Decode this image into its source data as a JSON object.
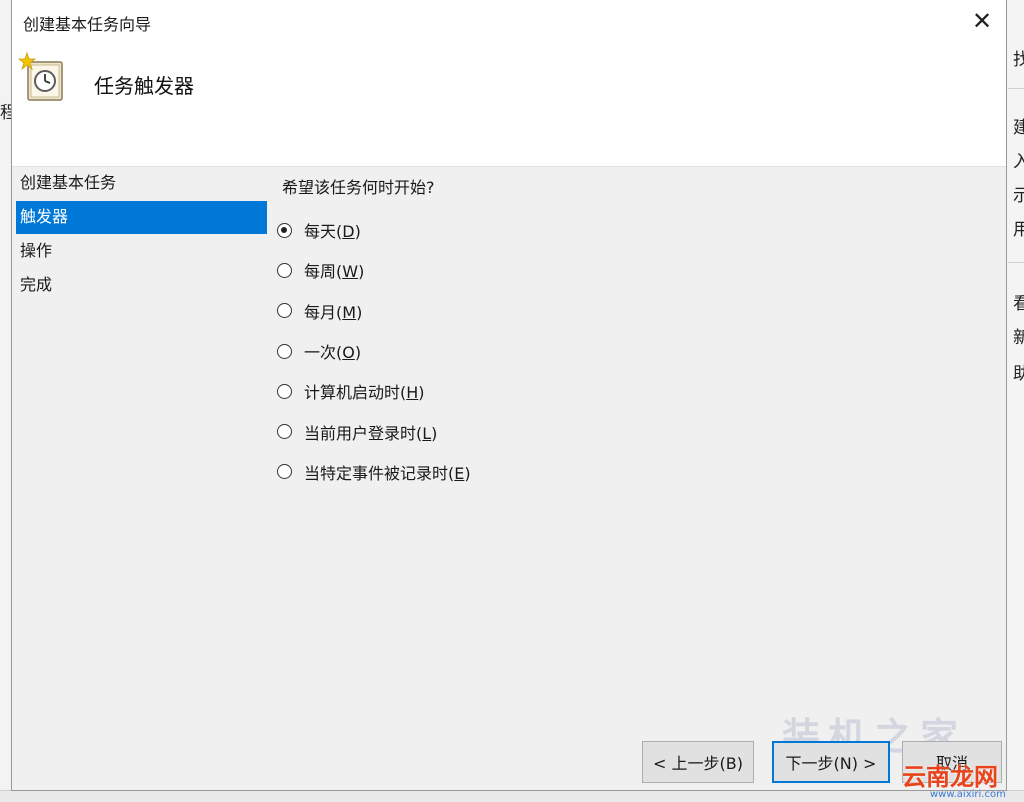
{
  "background": {
    "left_char": "程",
    "right_chars": [
      "找",
      "建",
      "入",
      "示",
      "用",
      "看",
      "新",
      "助"
    ]
  },
  "dialog": {
    "title": "创建基本任务向导",
    "close_label": "✕",
    "header_title": "任务触发器",
    "icon": "task-scheduler-clock-icon"
  },
  "nav": {
    "items": [
      {
        "label": "创建基本任务",
        "active": false
      },
      {
        "label": "触发器",
        "active": true
      },
      {
        "label": "操作",
        "active": false
      },
      {
        "label": "完成",
        "active": false
      }
    ]
  },
  "content": {
    "question": "希望该任务何时开始?",
    "options": [
      {
        "label": "每天(",
        "key": "D",
        "suffix": ")",
        "checked": true
      },
      {
        "label": "每周(",
        "key": "W",
        "suffix": ")",
        "checked": false
      },
      {
        "label": "每月(",
        "key": "M",
        "suffix": ")",
        "checked": false
      },
      {
        "label": "一次(",
        "key": "O",
        "suffix": ")",
        "checked": false
      },
      {
        "label": "计算机启动时(",
        "key": "H",
        "suffix": ")",
        "checked": false
      },
      {
        "label": "当前用户登录时(",
        "key": "L",
        "suffix": ")",
        "checked": false
      },
      {
        "label": "当特定事件被记录时(",
        "key": "E",
        "suffix": ")",
        "checked": false
      }
    ]
  },
  "buttons": {
    "back": "< 上一步(B)",
    "next": "下一步(N) >",
    "cancel": "取消"
  },
  "watermark": {
    "text": "装机之家",
    "logo": "云南龙网",
    "url": "www.aixiri.com"
  },
  "colors": {
    "accent": "#0078d7"
  }
}
